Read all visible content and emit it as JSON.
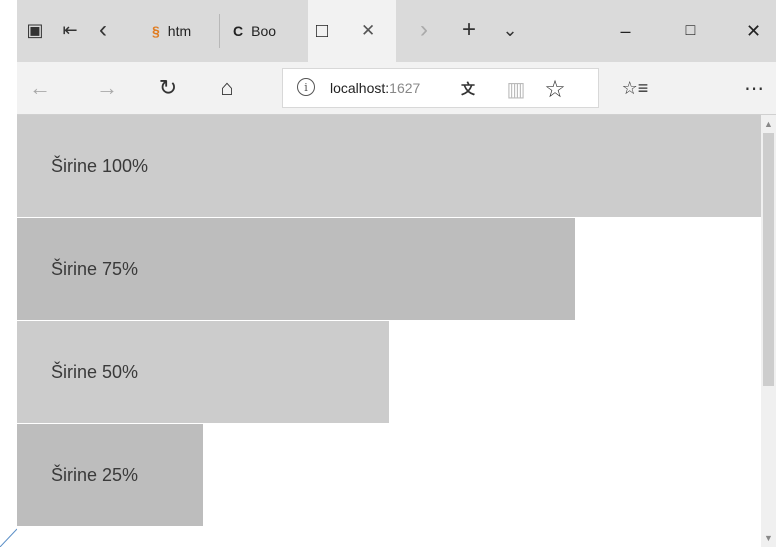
{
  "tabs": [
    {
      "label": "htm",
      "favicon": "§"
    },
    {
      "label": "Boo",
      "favicon": "C"
    }
  ],
  "address": {
    "host": "localhost:",
    "port": "1627"
  },
  "bars": [
    {
      "label": "Širine 100%",
      "percent": 100,
      "color": "#cccccc"
    },
    {
      "label": "Širine 75%",
      "percent": 75,
      "color": "#bdbdbd"
    },
    {
      "label": "Širine 50%",
      "percent": 50,
      "color": "#cccccc"
    },
    {
      "label": "Širine 25%",
      "percent": 25,
      "color": "#bdbdbd"
    }
  ],
  "colors": {
    "chrome": "#dadada",
    "toolbar": "#f2f2f2",
    "page": "#ffffff"
  },
  "icons": {
    "tab_preview": "▣",
    "set_aside": "⇤",
    "tabs_back": "‹",
    "tabs_forward": "›",
    "new_tab": "+",
    "tab_list": "⌄",
    "minimize": "–",
    "maximize": "□",
    "close": "✕",
    "back": "←",
    "forward": "→",
    "refresh": "↻",
    "home": "⌂",
    "translate": "文",
    "reading_view": "▥",
    "favorite": "☆",
    "favorites_hub": "☆≡",
    "more": "⋯"
  }
}
